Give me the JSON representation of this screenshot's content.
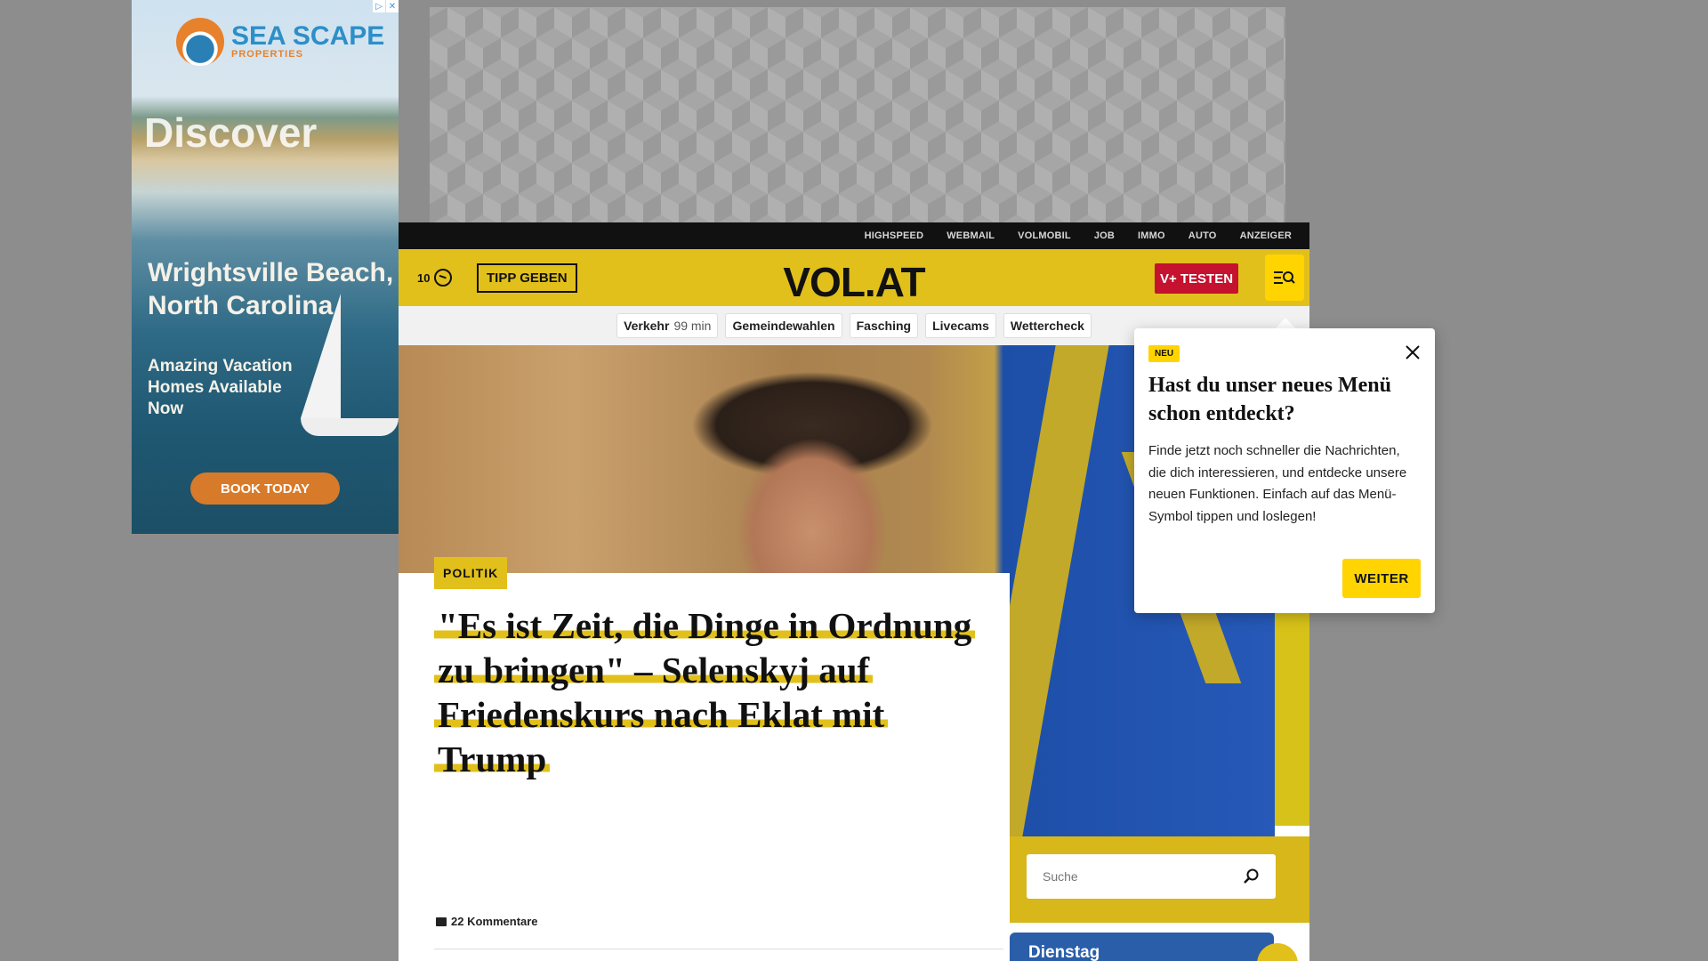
{
  "ad_left": {
    "brand": "SEA SCAPE",
    "brand_sub": "PROPERTIES",
    "headline_top": "Discover",
    "headline": "Wrightsville Beach, North Carolina",
    "subline": "Amazing Vacation Homes Available Now",
    "cta": "BOOK TODAY",
    "badge_info": "▷",
    "badge_close": "✕"
  },
  "topbar": {
    "links": [
      "HIGHSPEED",
      "WEBMAIL",
      "VOLMOBIL",
      "JOB",
      "IMMO",
      "AUTO",
      "ANZEIGER"
    ]
  },
  "header": {
    "temperature": "10",
    "weather_icon": "cloud-icon",
    "tipp_label": "TIPP GEBEN",
    "logo": "VOL.AT",
    "vplus_label": "V+ TESTEN",
    "menu_icon": "menu-search-icon",
    "accent": "#e2c01b"
  },
  "subnav": {
    "traffic_label": "Verkehr",
    "traffic_value": "99 min",
    "items": [
      "Gemeindewahlen",
      "Fasching",
      "Livecams",
      "Wettercheck"
    ]
  },
  "article": {
    "category": "POLITIK",
    "headline": "\"Es ist Zeit, die Dinge in Ordnung zu bringen\" – Selenskyj auf Friedenskurs nach Eklat mit Trump",
    "comments": "22 Kommentare"
  },
  "sidebar": {
    "search_placeholder": "Suche",
    "day_label": "Dienstag"
  },
  "popover": {
    "badge": "NEU",
    "title": "Hast du unser neues Menü schon entdeckt?",
    "text": "Finde jetzt noch schneller die Nachrichten, die dich interessieren, und entdecke unsere neuen Funktionen. Einfach auf das Menü-Symbol tippen und loslegen!",
    "button": "WEITER"
  }
}
